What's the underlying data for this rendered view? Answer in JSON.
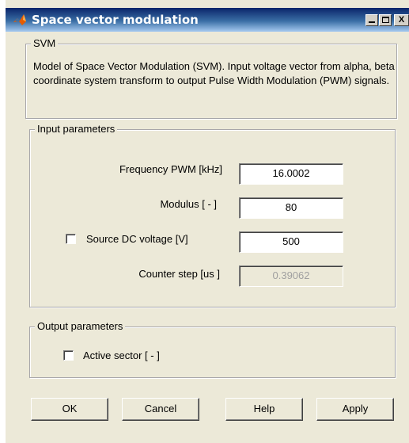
{
  "window": {
    "title": "Space vector modulation",
    "icon": "matlab-logo-icon",
    "controls": [
      "minimize-icon",
      "maximize-icon",
      "close-icon"
    ],
    "close_glyph": "X"
  },
  "svm_group": {
    "label": "SVM",
    "description": "Model of Space Vector Modulation (SVM). Input voltage vector from alpha, beta coordinate system transform to output Pulse Width Modulation (PWM) signals."
  },
  "input_group": {
    "label": "Input parameters",
    "frequency": {
      "label": "Frequency PWM [kHz]",
      "value": "16.0002"
    },
    "modulus": {
      "label": "Modulus [ - ]",
      "value": "80"
    },
    "source_dc": {
      "label": "Source DC voltage [V]",
      "value": "500",
      "checked": false
    },
    "counter_step": {
      "label": "Counter step [us ]",
      "value": "0.39062",
      "enabled": false
    }
  },
  "output_group": {
    "label": "Output parameters",
    "active_sector": {
      "label": "Active sector [ - ]",
      "checked": false
    }
  },
  "buttons": {
    "ok": "OK",
    "cancel": "Cancel",
    "help": "Help",
    "apply": "Apply"
  },
  "colors": {
    "dialog_bg": "#ece9d8",
    "titlebar_start": "#0a246a",
    "titlebar_end": "#a6caf0"
  }
}
